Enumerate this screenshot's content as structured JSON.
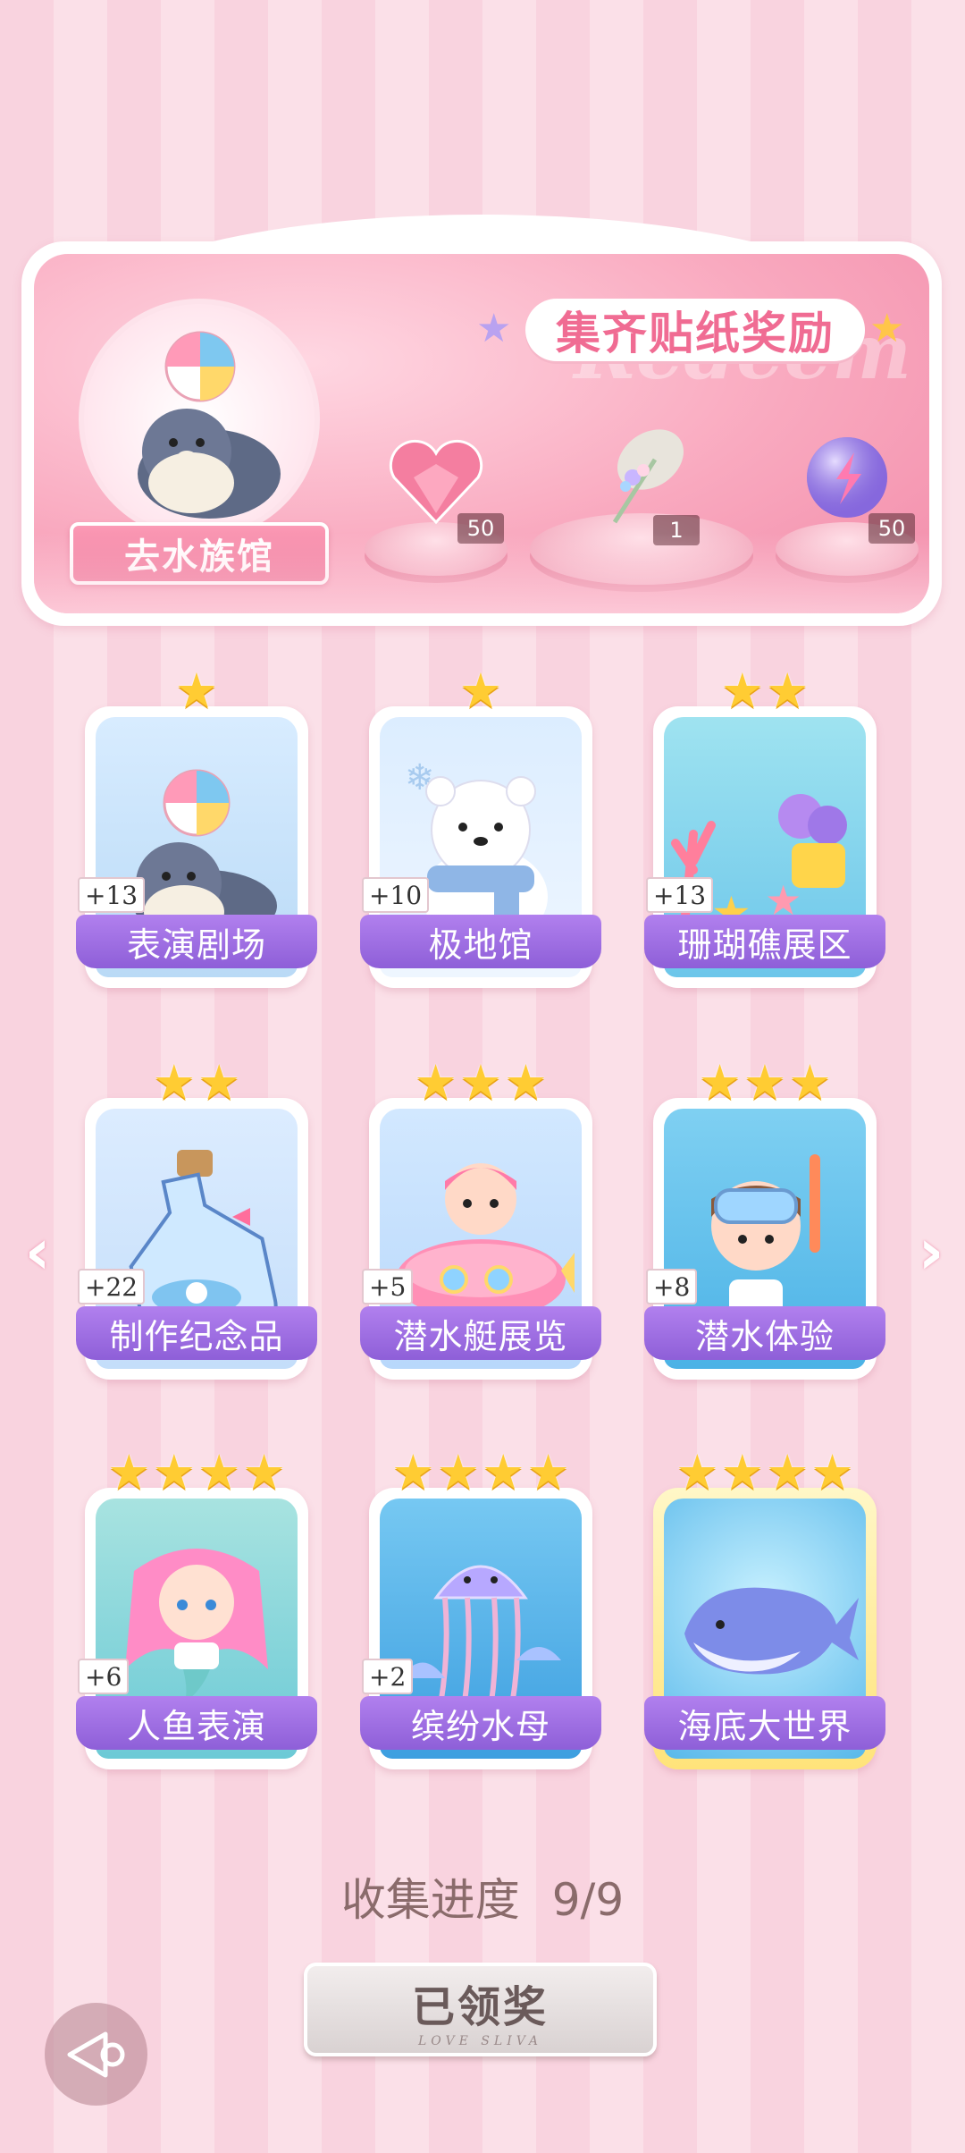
{
  "banner": {
    "title": "集齐贴纸奖励",
    "watermark": "Redeem",
    "go_button": "去水族馆",
    "rewards": [
      {
        "icon": "heart-gem-icon",
        "count": "50"
      },
      {
        "icon": "bouquet-icon",
        "count": "1"
      },
      {
        "icon": "energy-orb-icon",
        "count": "50"
      }
    ]
  },
  "cards": [
    {
      "label": "表演剧场",
      "bonus": "+13",
      "stars": 1,
      "art": "seal-with-ball"
    },
    {
      "label": "极地馆",
      "bonus": "+10",
      "stars": 1,
      "art": "polar-bear"
    },
    {
      "label": "珊瑚礁展区",
      "bonus": "+13",
      "stars": 2,
      "art": "coral-reef"
    },
    {
      "label": "制作纪念品",
      "bonus": "+22",
      "stars": 2,
      "art": "message-bottle"
    },
    {
      "label": "潜水艇展览",
      "bonus": "+5",
      "stars": 3,
      "art": "submarine-girl"
    },
    {
      "label": "潜水体验",
      "bonus": "+8",
      "stars": 3,
      "art": "snorkel-girl"
    },
    {
      "label": "人鱼表演",
      "bonus": "+6",
      "stars": 4,
      "art": "mermaid"
    },
    {
      "label": "缤纷水母",
      "bonus": "+2",
      "stars": 4,
      "art": "jellyfish"
    },
    {
      "label": "海底大世界",
      "bonus": "",
      "stars": 4,
      "art": "whale"
    }
  ],
  "progress": {
    "label": "收集进度",
    "value": "9/9"
  },
  "claim_button": {
    "label": "已领奖",
    "sub": "LOVE SLIVA"
  },
  "colors": {
    "accent_pink": "#f06c93",
    "label_purple": "#9b6be0",
    "star_gold": "#ffcc33"
  }
}
